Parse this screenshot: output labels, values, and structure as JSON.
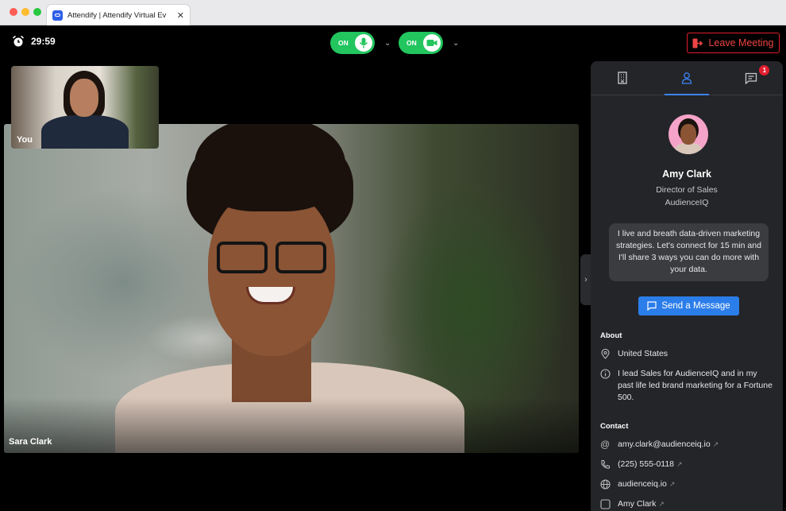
{
  "browser": {
    "tab_title": "Attendify | Attendify Virtual Ev",
    "traffic_colors": [
      "#ff5f57",
      "#febc2e",
      "#28c840"
    ]
  },
  "header": {
    "timer": "29:59",
    "mic_toggle": {
      "label": "ON",
      "icon": "microphone-icon"
    },
    "camera_toggle": {
      "label": "ON",
      "icon": "video-camera-icon"
    },
    "leave_label": "Leave Meeting"
  },
  "videos": {
    "self_label": "You",
    "main_label": "Sara Clark"
  },
  "panel": {
    "tabs": [
      {
        "icon": "building-icon"
      },
      {
        "icon": "person-icon",
        "active": true
      },
      {
        "icon": "chat-icon",
        "badge": "1"
      }
    ],
    "profile": {
      "name": "Amy Clark",
      "title": "Director of Sales",
      "company": "AudienceIQ",
      "bio": "I live and breath data-driven marketing strategies. Let's connect for 15 min and I'll share 3 ways you can do more with your data.",
      "send_label": "Send a Message"
    },
    "about": {
      "heading": "About",
      "location": "United States",
      "description": "I lead Sales for AudienceIQ and in my past life led brand marketing for a Fortune 500."
    },
    "contact": {
      "heading": "Contact",
      "email": "amy.clark@audienceiq.io",
      "phone": "(225) 555-0118",
      "website": "audienceiq.io",
      "linkedin": "Amy Clark"
    }
  },
  "colors": {
    "accent": "#2b7de9",
    "toggle_on": "#22c55e",
    "leave": "#ef4444",
    "panel_bg": "#242528"
  }
}
